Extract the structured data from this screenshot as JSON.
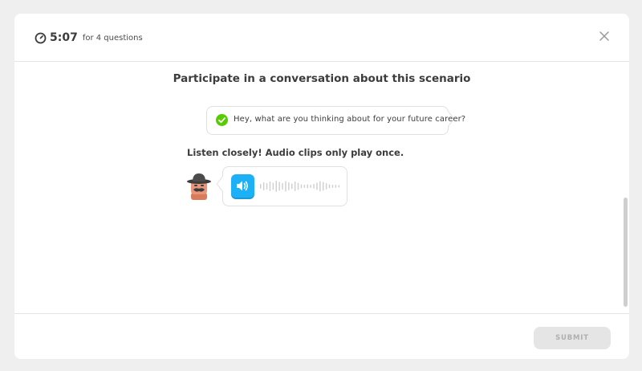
{
  "header": {
    "timer_icon": "stopwatch-icon",
    "timer_value": "5:07",
    "timer_caption": "for 4 questions",
    "close_icon": "close-icon"
  },
  "main": {
    "title": "Participate in a conversation about this scenario",
    "prior_message": {
      "status_icon": "checkmark-icon",
      "text": "Hey, what are you thinking about for your future career?"
    },
    "instruction": "Listen closely! Audio clips only play once.",
    "speaker": {
      "avatar_icon": "character-avatar-icon"
    },
    "audio_clip": {
      "play_icon": "speaker-icon"
    }
  },
  "footer": {
    "submit_label": "SUBMIT"
  },
  "colors": {
    "accent_blue": "#1cb0f6",
    "success_green": "#58cc02",
    "disabled_gray": "#e5e5e5",
    "text_dark": "#3c3c3c"
  }
}
